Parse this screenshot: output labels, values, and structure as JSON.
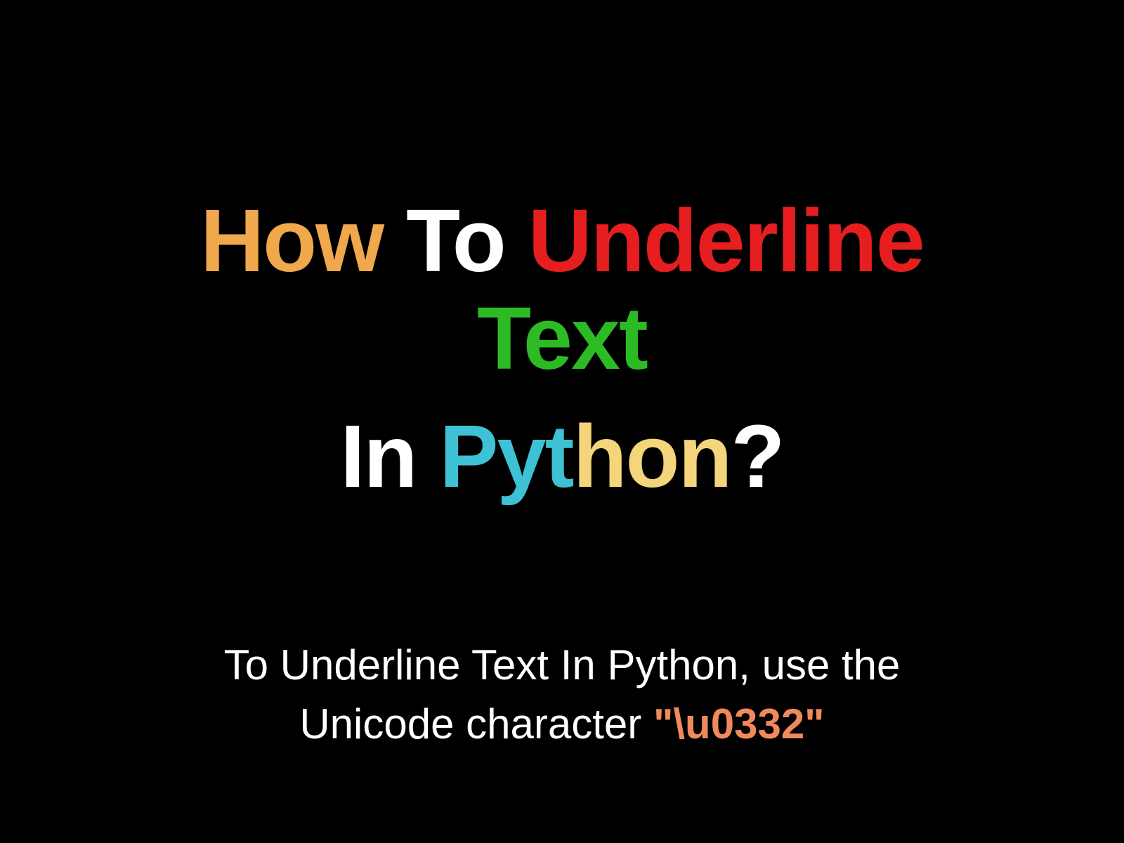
{
  "title": {
    "line1": {
      "word1": "How",
      "word2": "To",
      "word3": "Underline",
      "word4": "Text"
    },
    "line2": {
      "word1": "In",
      "word2_part1": "Pyt",
      "word2_part2": "hon",
      "word3": "?"
    }
  },
  "subtitle": {
    "line1": "To Underline Text In Python, use the",
    "line2_part1": "Unicode character ",
    "line2_code": "\"\\u0332\""
  }
}
